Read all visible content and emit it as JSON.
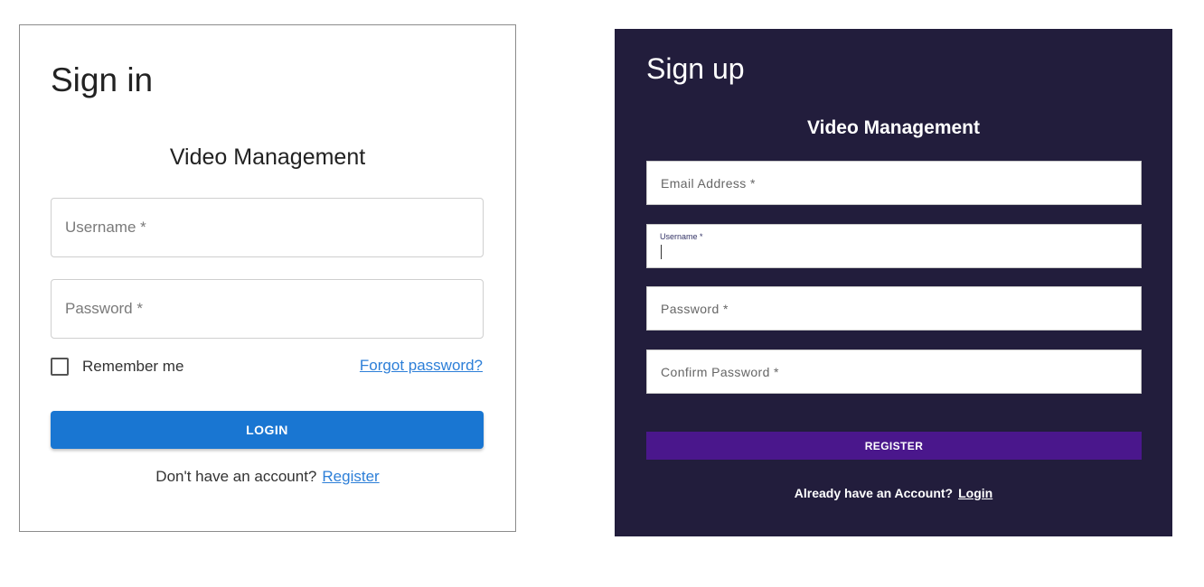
{
  "signin": {
    "title": "Sign in",
    "subtitle": "Video Management",
    "username_placeholder": "Username *",
    "password_placeholder": "Password *",
    "remember_label": "Remember me",
    "forgot_link": "Forgot password?",
    "login_button": "LOGIN",
    "footer_text": "Don't have an account?",
    "register_link": "Register"
  },
  "signup": {
    "title": "Sign up",
    "subtitle": "Video Management",
    "email_placeholder": "Email Address *",
    "username_label": "Username *",
    "password_placeholder": "Password *",
    "confirm_placeholder": "Confirm Password *",
    "register_button": "REGISTER",
    "footer_text": "Already have an Account?",
    "login_link": "Login"
  },
  "colors": {
    "signin_primary": "#1976d2",
    "signin_link": "#2d7fd8",
    "signup_background": "#221d3c",
    "signup_button": "#4a178c"
  }
}
